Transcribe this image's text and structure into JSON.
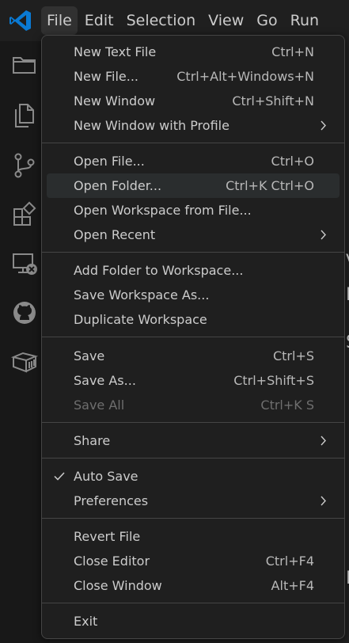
{
  "menubar": {
    "items": [
      "File",
      "Edit",
      "Selection",
      "View",
      "Go",
      "Run"
    ]
  },
  "file_menu": {
    "items": [
      {
        "label": "New Text File",
        "shortcut": "Ctrl+N"
      },
      {
        "label": "New File...",
        "shortcut": "Ctrl+Alt+Windows+N"
      },
      {
        "label": "New Window",
        "shortcut": "Ctrl+Shift+N"
      },
      {
        "label": "New Window with Profile",
        "shortcut": ""
      },
      {
        "label": "Open File...",
        "shortcut": "Ctrl+O"
      },
      {
        "label": "Open Folder...",
        "shortcut": "Ctrl+K Ctrl+O"
      },
      {
        "label": "Open Workspace from File...",
        "shortcut": ""
      },
      {
        "label": "Open Recent",
        "shortcut": ""
      },
      {
        "label": "Add Folder to Workspace...",
        "shortcut": ""
      },
      {
        "label": "Save Workspace As...",
        "shortcut": ""
      },
      {
        "label": "Duplicate Workspace",
        "shortcut": ""
      },
      {
        "label": "Save",
        "shortcut": "Ctrl+S"
      },
      {
        "label": "Save As...",
        "shortcut": "Ctrl+Shift+S"
      },
      {
        "label": "Save All",
        "shortcut": "Ctrl+K S"
      },
      {
        "label": "Share",
        "shortcut": ""
      },
      {
        "label": "Auto Save",
        "shortcut": ""
      },
      {
        "label": "Preferences",
        "shortcut": ""
      },
      {
        "label": "Revert File",
        "shortcut": ""
      },
      {
        "label": "Close Editor",
        "shortcut": "Ctrl+F4"
      },
      {
        "label": "Close Window",
        "shortcut": "Alt+F4"
      },
      {
        "label": "Exit",
        "shortcut": ""
      }
    ]
  },
  "states": {
    "hovered_item": "Open Folder...",
    "disabled_item": "Save All",
    "checked_item": "Auto Save"
  },
  "activity_bar_icons": [
    "explorer-icon",
    "files-icon",
    "source-control-icon",
    "extensions-icon",
    "remote-explorer-icon",
    "github-icon",
    "containers-icon"
  ],
  "colors": {
    "accent": "#0078d4",
    "menu_background": "#1f1f1f",
    "hover_background": "#2a2d2e",
    "separator": "#454545",
    "text": "#cccccc",
    "disabled_text": "#6e6e6e"
  }
}
